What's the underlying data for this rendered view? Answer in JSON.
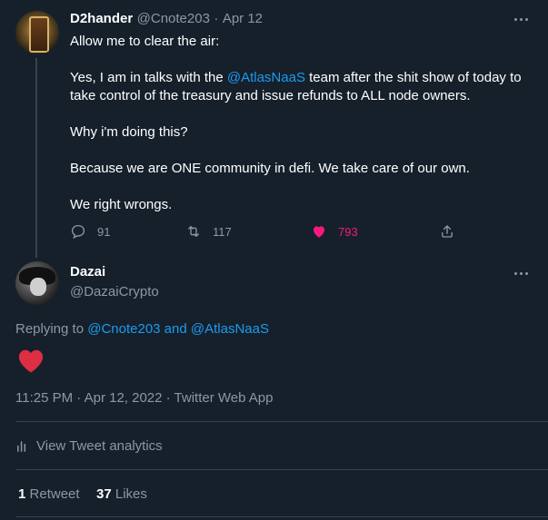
{
  "parent_tweet": {
    "display_name": "D2hander",
    "handle": "@Cnote203",
    "separator": "·",
    "date": "Apr 12",
    "paragraphs": {
      "p1": "Allow me to clear the air:",
      "p2_before": "Yes, I am in talks with the ",
      "p2_mention": "@AtlasNaaS",
      "p2_after": " team after the shit show of today to take control of the treasury and issue refunds to ALL node owners.",
      "p3": "Why i'm doing this?",
      "p4": "Because we are ONE community in defi. We take care of our own.",
      "p5": "We right wrongs."
    },
    "actions": {
      "replies": "91",
      "retweets": "117",
      "likes": "793"
    },
    "icons": {
      "reply": "reply-icon",
      "retweet": "retweet-icon",
      "like": "heart-filled-icon",
      "share": "share-icon",
      "more": "more-icon"
    }
  },
  "main_tweet": {
    "display_name": "Dazai",
    "handle": "@DazaiCrypto",
    "replying_prefix": "Replying to ",
    "replying_user1": "@Cnote203",
    "replying_and": " and ",
    "replying_user2": "@AtlasNaaS",
    "content_emoji": "❤️",
    "timestamp": "11:25 PM · Apr 12, 2022 · Twitter Web App",
    "analytics_label": "View Tweet analytics",
    "retweet_count": "1",
    "retweet_label": "Retweet",
    "like_count": "37",
    "like_label": "Likes"
  },
  "colors": {
    "background": "#15202b",
    "accent": "#1d9bf0",
    "like_pink": "#f91880",
    "muted": "#8b98a5",
    "divider": "#38444d",
    "heart_red": "#dd2e44"
  }
}
